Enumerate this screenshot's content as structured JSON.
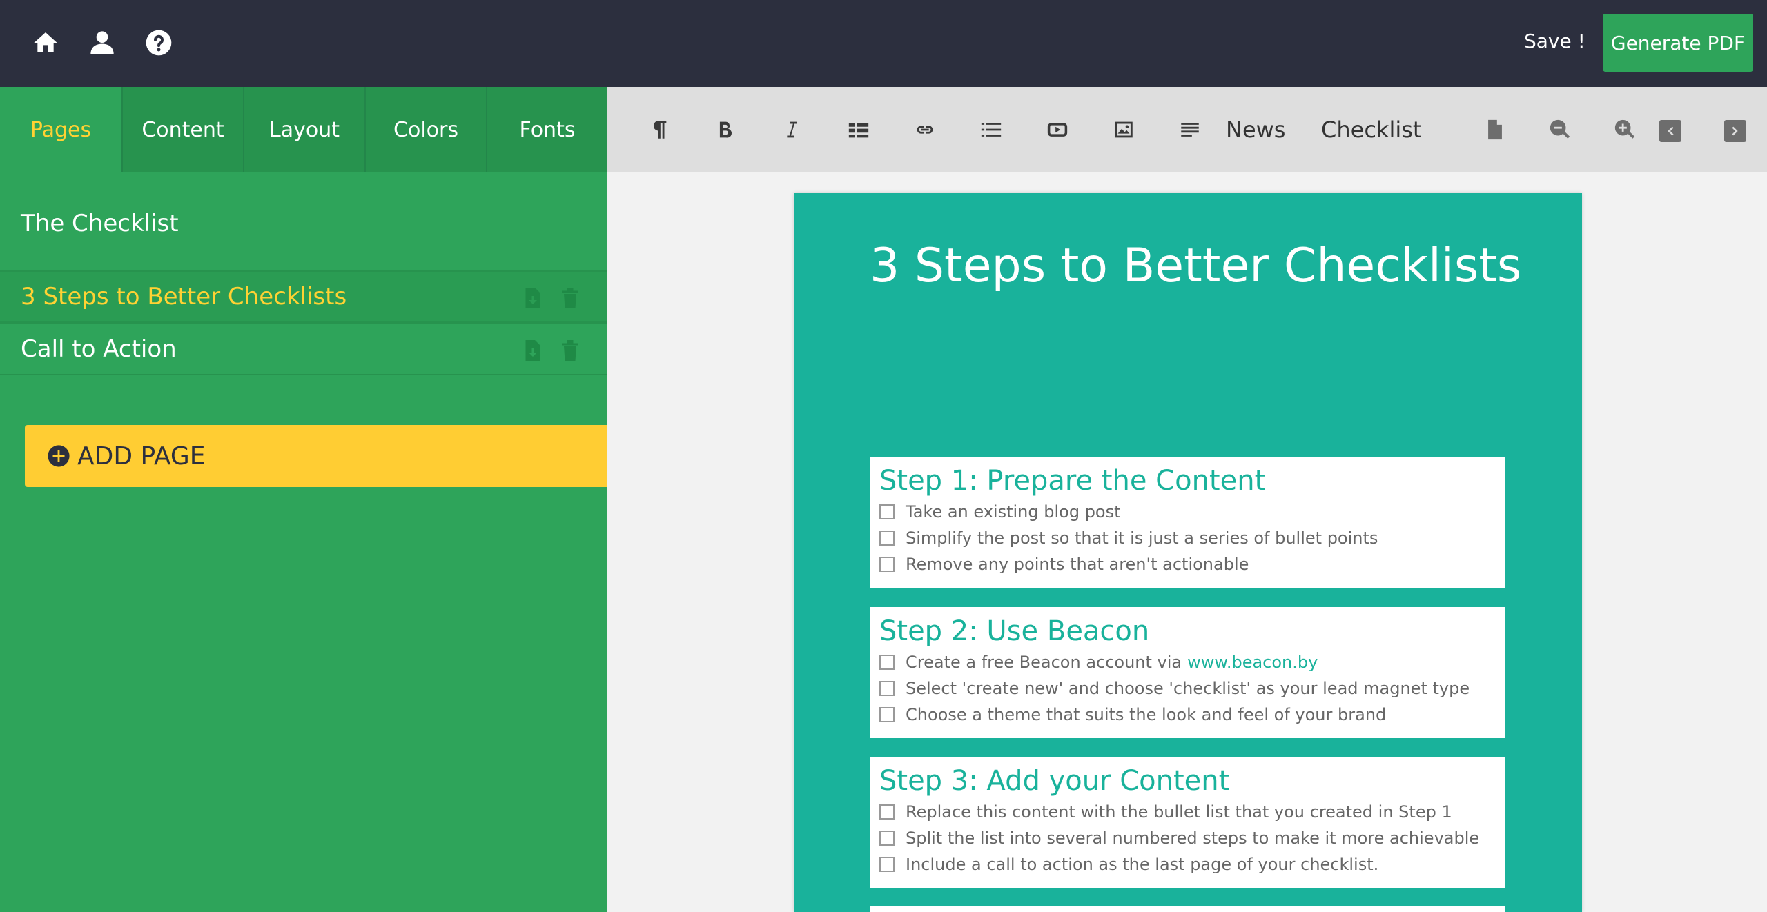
{
  "topbar": {
    "icons": [
      "home-icon",
      "user-icon",
      "help-icon"
    ],
    "save_label": "Save !",
    "generate_pdf_label": "Generate PDF"
  },
  "sidebar": {
    "tabs": [
      {
        "label": "Pages",
        "active": true
      },
      {
        "label": "Content"
      },
      {
        "label": "Layout"
      },
      {
        "label": "Colors"
      },
      {
        "label": "Fonts"
      }
    ],
    "pages": [
      {
        "label": "The Checklist"
      },
      {
        "label": "3 Steps to Better Checklists",
        "active": true
      },
      {
        "label": "Call to Action"
      }
    ],
    "add_page_label": "ADD PAGE"
  },
  "toolbar": {
    "icons": [
      "paragraph-icon",
      "bold-icon",
      "italic-icon",
      "table-icon",
      "link-icon",
      "list-icon",
      "video-icon",
      "image-icon",
      "align-icon"
    ],
    "news_label": "News",
    "checklist_label": "Checklist",
    "right_icons": [
      "page-icon",
      "zoom-out-icon",
      "zoom-in-icon",
      "prev-page-icon",
      "next-page-icon"
    ]
  },
  "document": {
    "title": "3 Steps to Better Checklists",
    "steps": [
      {
        "heading": "Step 1: Prepare the Content",
        "items": [
          "Take an existing blog post",
          "Simplify the post so that it is just a series of bullet points",
          "Remove any points that aren't actionable"
        ]
      },
      {
        "heading": "Step 2: Use Beacon",
        "items": [
          "Create a free Beacon account via",
          "Select 'create new' and choose 'checklist' as your lead magnet type",
          "Choose a theme that suits the look and feel of your brand"
        ],
        "link": "www.beacon.by"
      },
      {
        "heading": "Step 3: Add your Content",
        "items": [
          "Replace this content with the bullet list that you created in Step 1",
          "Split the list into several numbered steps to make it more achievable",
          "Include a call to action as the last page of your checklist."
        ]
      }
    ]
  },
  "colors": {
    "topbar": "#2c2f3e",
    "sidebar": "#2ea45a",
    "accent_yellow": "#ffcd33",
    "doc_teal": "#19b29b"
  }
}
